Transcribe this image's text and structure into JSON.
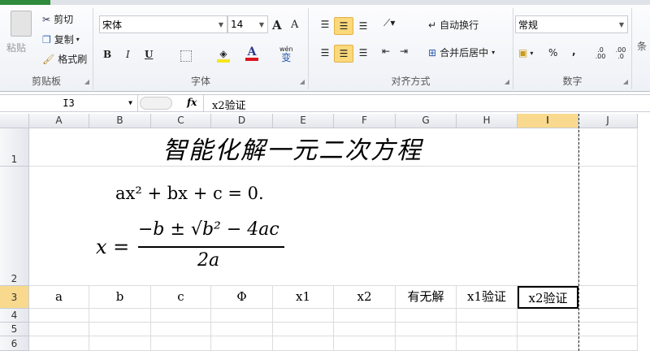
{
  "clipboard": {
    "paste": "粘贴",
    "cut": "剪切",
    "copy": "复制",
    "format_painter": "格式刷",
    "group": "剪贴板"
  },
  "font": {
    "name": "宋体",
    "size": "14",
    "bold": "B",
    "italic": "I",
    "underline": "U",
    "grow": "A",
    "shrink": "A",
    "font_color": "A",
    "phonetic": "wén",
    "phonetic_char": "变",
    "group": "字体",
    "fill_color": "#f5e620",
    "text_color": "#d9151c"
  },
  "alignment": {
    "wrap": "自动换行",
    "merge": "合并后居中",
    "group": "对齐方式"
  },
  "number": {
    "format": "常规",
    "percent": "%",
    "comma": ",",
    "inc_decimal": ".0 .00",
    "dec_decimal": ".00 .0",
    "group": "数字"
  },
  "styles": {
    "partial": "条"
  },
  "formula_bar": {
    "name_box": "I3",
    "fx": "fx",
    "content": "x2验证"
  },
  "columns": [
    "A",
    "B",
    "C",
    "D",
    "E",
    "F",
    "G",
    "H",
    "I",
    "J"
  ],
  "rows": [
    "1",
    "2",
    "3",
    "4",
    "5",
    "6"
  ],
  "sheet": {
    "title": "智能化解一元二次方程",
    "equation": "ax² + bx + c = 0.",
    "formula_lhs": "x =",
    "formula_num": "−b ± √b² − 4ac",
    "formula_den": "2a",
    "row3": [
      "a",
      "b",
      "c",
      "Φ",
      "x1",
      "x2",
      "有无解",
      "x1验证",
      "x2验证"
    ]
  },
  "accent": "#fbd87a"
}
